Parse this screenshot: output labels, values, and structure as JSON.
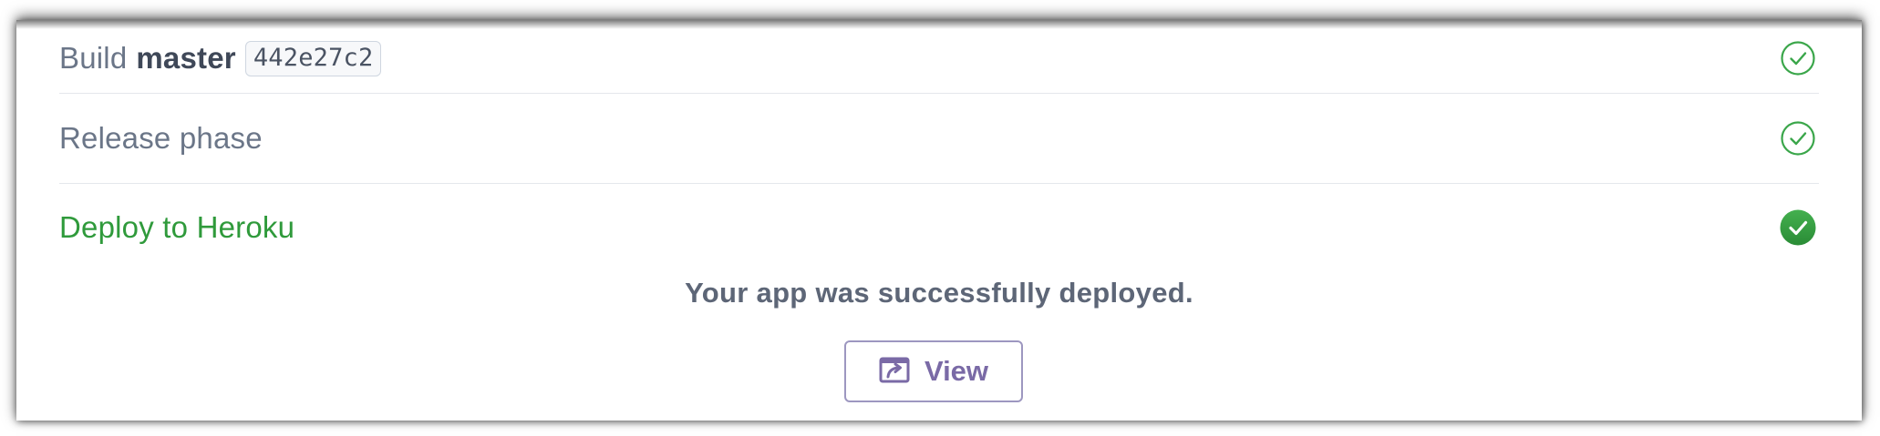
{
  "steps": {
    "build": {
      "prefix": "Build",
      "branch": "master",
      "commit": "442e27c2",
      "status_icon": "check-circle-outline-icon"
    },
    "release": {
      "label": "Release phase",
      "status_icon": "check-circle-outline-icon"
    },
    "deploy": {
      "label": "Deploy to Heroku",
      "status_icon": "check-circle-filled-icon"
    }
  },
  "result": {
    "message": "Your app was successfully deployed.",
    "view_button_label": "View",
    "view_button_icon": "external-link-icon"
  },
  "colors": {
    "success_green": "#2f9a3b",
    "muted_text": "#6b7688",
    "button_purple": "#7a6aa6",
    "divider": "#e4e7ec"
  }
}
